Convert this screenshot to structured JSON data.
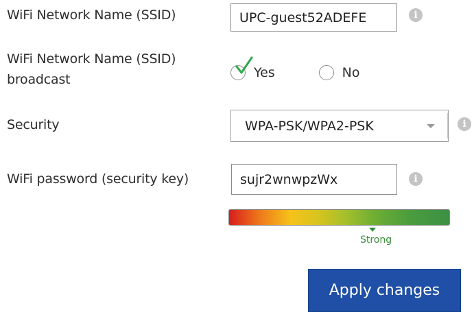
{
  "form": {
    "ssid": {
      "label": "WiFi Network Name (SSID)",
      "value": "UPC-guest52ADEFE",
      "info": "i"
    },
    "broadcast": {
      "label_line1": "WiFi Network Name (SSID)",
      "label_line2": "broadcast",
      "options": [
        "Yes",
        "No"
      ],
      "selected": "Yes"
    },
    "security": {
      "label": "Security",
      "value": "WPA-PSK/WPA2-PSK",
      "info": "i"
    },
    "password": {
      "label": "WiFi password (security key)",
      "value": "sujr2wnwpzWx",
      "info": "i",
      "strength_label": "Strong"
    },
    "apply_label": "Apply changes"
  },
  "colors": {
    "button": "#1f4fa6",
    "check": "#2fa84a",
    "strength_text": "#3b8f3a"
  },
  "icons": [
    "info-icon",
    "check-icon",
    "radio-icon",
    "caret-down-icon"
  ]
}
